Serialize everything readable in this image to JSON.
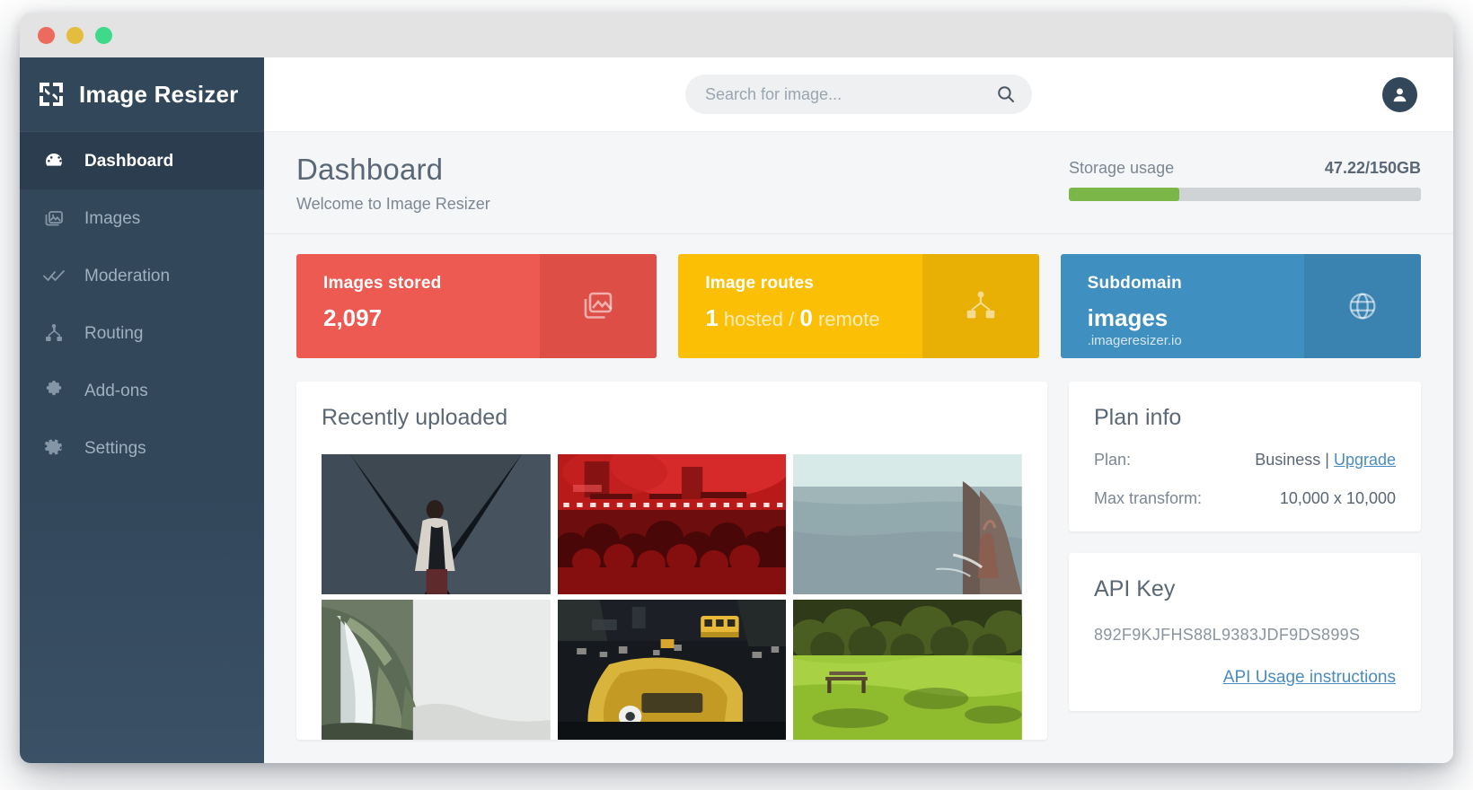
{
  "window": {
    "controls": [
      "close",
      "minimize",
      "maximize"
    ]
  },
  "sidebar": {
    "brand": "Image Resizer",
    "brand_icon": "resize-logo-icon",
    "items": [
      {
        "label": "Dashboard",
        "icon": "speedometer-icon",
        "active": true
      },
      {
        "label": "Images",
        "icon": "images-icon",
        "active": false
      },
      {
        "label": "Moderation",
        "icon": "double-check-icon",
        "active": false
      },
      {
        "label": "Routing",
        "icon": "sitemap-icon",
        "active": false
      },
      {
        "label": "Add-ons",
        "icon": "puzzle-icon",
        "active": false
      },
      {
        "label": "Settings",
        "icon": "gear-icon",
        "active": false
      }
    ]
  },
  "topbar": {
    "search_placeholder": "Search for image...",
    "search_value": "",
    "search_icon": "search-icon",
    "avatar_icon": "user-avatar-icon"
  },
  "page": {
    "title": "Dashboard",
    "subtitle": "Welcome to Image Resizer"
  },
  "storage": {
    "label": "Storage usage",
    "value": "47.22/150GB",
    "used_gb": 47.22,
    "total_gb": 150,
    "percent": 31.5,
    "fill_color": "#7ab648",
    "track_color": "#cfd3d6"
  },
  "stats": [
    {
      "title": "Images stored",
      "value": "2,097",
      "icon": "images-stack-icon",
      "color": "#ed5a52"
    },
    {
      "title": "Image routes",
      "value_hosted": "1",
      "value_hosted_label": "hosted",
      "separator": "/",
      "value_remote": "0",
      "value_remote_label": "remote",
      "icon": "sitemap-icon",
      "color": "#fbbf05"
    },
    {
      "title": "Subdomain",
      "value": "images",
      "subvalue": ".imageresizer.io",
      "icon": "globe-icon",
      "color": "#3f8fc1"
    }
  ],
  "recent": {
    "title": "Recently uploaded",
    "thumbnails": [
      {
        "name": "person-in-dark-v-shaped-corridor"
      },
      {
        "name": "red-lit-concert-crowd"
      },
      {
        "name": "sea-cliff-and-rock-stack"
      },
      {
        "name": "waterfall-on-green-cliff"
      },
      {
        "name": "night-street-with-yellow-taxi"
      },
      {
        "name": "green-meadow-with-trees"
      }
    ]
  },
  "plan_info": {
    "title": "Plan info",
    "rows": [
      {
        "key": "Plan:",
        "value": "Business",
        "divider": "|",
        "link": "Upgrade"
      },
      {
        "key": "Max transform:",
        "value": "10,000 x 10,000"
      }
    ]
  },
  "api_key": {
    "title": "API Key",
    "value": "892F9KJFHS88L9383JDF9DS899S",
    "link": "API Usage instructions"
  }
}
